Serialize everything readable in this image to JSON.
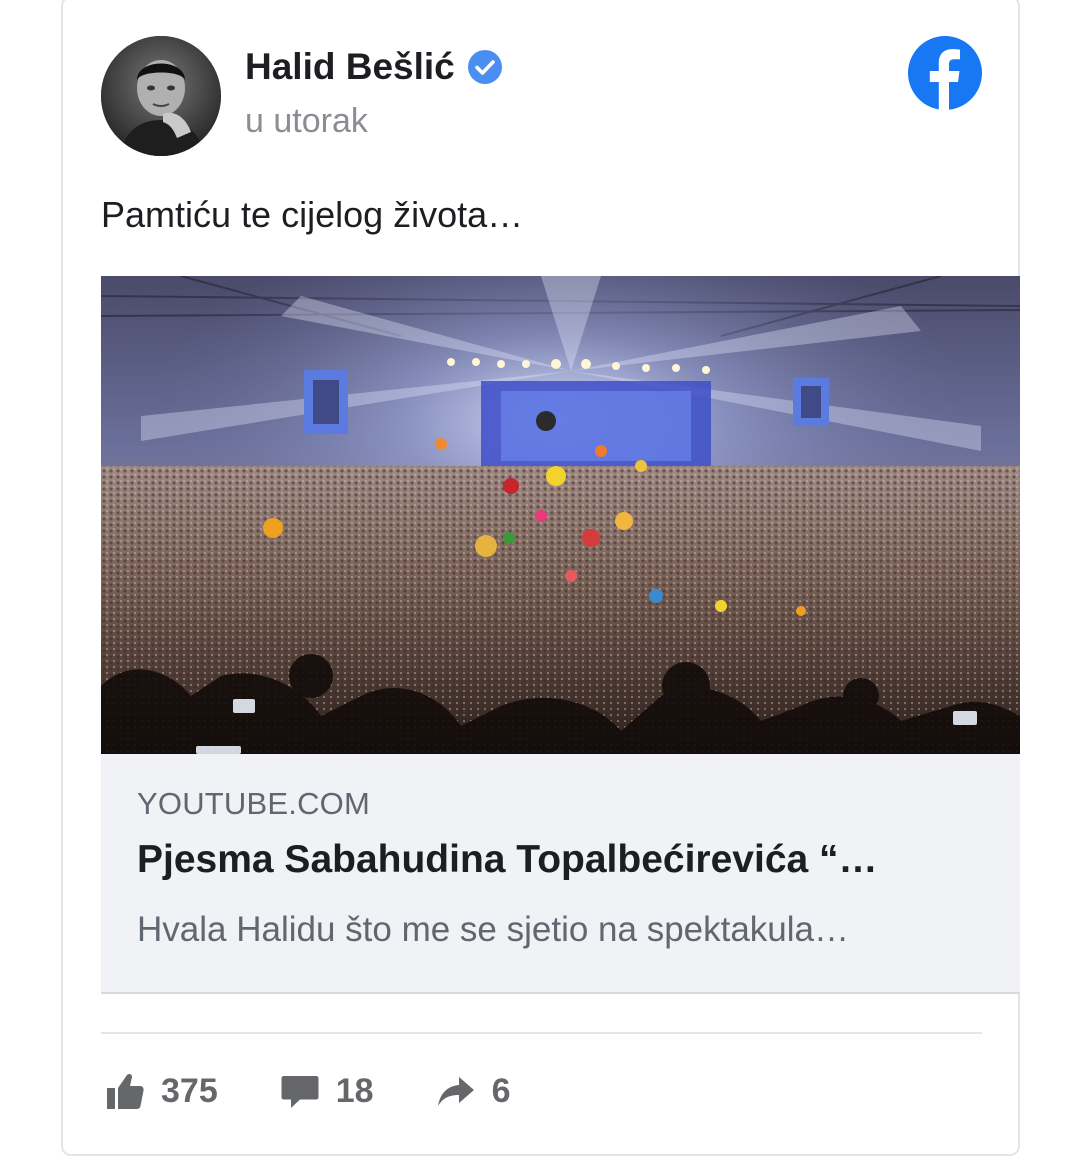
{
  "post": {
    "author": "Halid Bešlić",
    "time": "u utorak",
    "text": "Pamtiću te cijelog života…"
  },
  "link": {
    "domain": "YOUTUBE.COM",
    "title": "Pjesma Sabahudina Topalbećirevića “…",
    "description": "Hvala Halidu što me se sjetio na spektakula…"
  },
  "stats": {
    "likes": "375",
    "comments": "18",
    "shares": "6"
  },
  "icons": {
    "verified": "verified-badge-icon",
    "platform": "facebook-logo-icon",
    "like": "thumbs-up-icon",
    "comment": "comment-bubble-icon",
    "share": "share-arrow-icon"
  },
  "colors": {
    "facebook_blue": "#1877f2",
    "verified_blue": "#4b8ef2",
    "text_primary": "#1c1e21",
    "text_secondary": "#606770",
    "preview_bg": "#f0f2f5"
  }
}
